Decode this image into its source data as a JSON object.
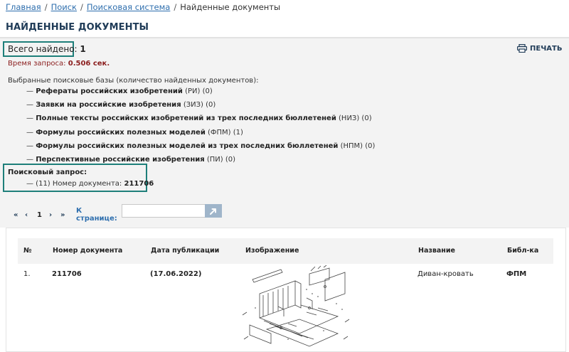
{
  "breadcrumb": {
    "items": [
      "Главная",
      "Поиск",
      "Поисковая система"
    ],
    "current": "Найденные документы",
    "separator": "/"
  },
  "page_title": "НАЙДЕННЫЕ ДОКУМЕНТЫ",
  "summary": {
    "found_label": "Всего найдено:",
    "found_count": "1",
    "time_label": "Время запроса:",
    "time_value": "0.506 сек."
  },
  "print_label": "ПЕЧАТЬ",
  "bases": {
    "heading": "Выбранные поисковые базы (количество найденных документов):",
    "dash": "—",
    "items": [
      {
        "name": "Рефераты российских изобретений",
        "code": "(РИ) (0)"
      },
      {
        "name": "Заявки на российские изобретения",
        "code": "(ЗИЗ) (0)"
      },
      {
        "name": "Полные тексты российских изобретений из трех последних бюллетеней",
        "code": "(НИЗ) (0)"
      },
      {
        "name": "Формулы российских полезных моделей",
        "code": "(ФПМ) (1)"
      },
      {
        "name": "Формулы российских полезных моделей из трех последних бюллетеней",
        "code": "(НПМ) (0)"
      },
      {
        "name": "Перспективные российские изобретения",
        "code": "(ПИ) (0)"
      }
    ]
  },
  "query": {
    "label": "Поисковый запрос:",
    "text": "— (11) Номер документа:",
    "value": "211706"
  },
  "pager": {
    "first": "«",
    "prev": "‹",
    "page": "1",
    "next": "›",
    "last": "»",
    "to_page_label": "К странице:",
    "input_value": ""
  },
  "table": {
    "headers": [
      "№",
      "Номер документа",
      "Дата публикации",
      "Изображение",
      "Название",
      "Библ-ка"
    ],
    "rows": [
      {
        "num": "1.",
        "doc_number": "211706",
        "date": "(17.06.2022)",
        "title": "Диван-кровать",
        "library": "ФПМ"
      }
    ]
  },
  "colors": {
    "accent": "#1e7f7a",
    "link": "#2f6fae",
    "title": "#1f3b57",
    "time": "#8b1e1e"
  }
}
